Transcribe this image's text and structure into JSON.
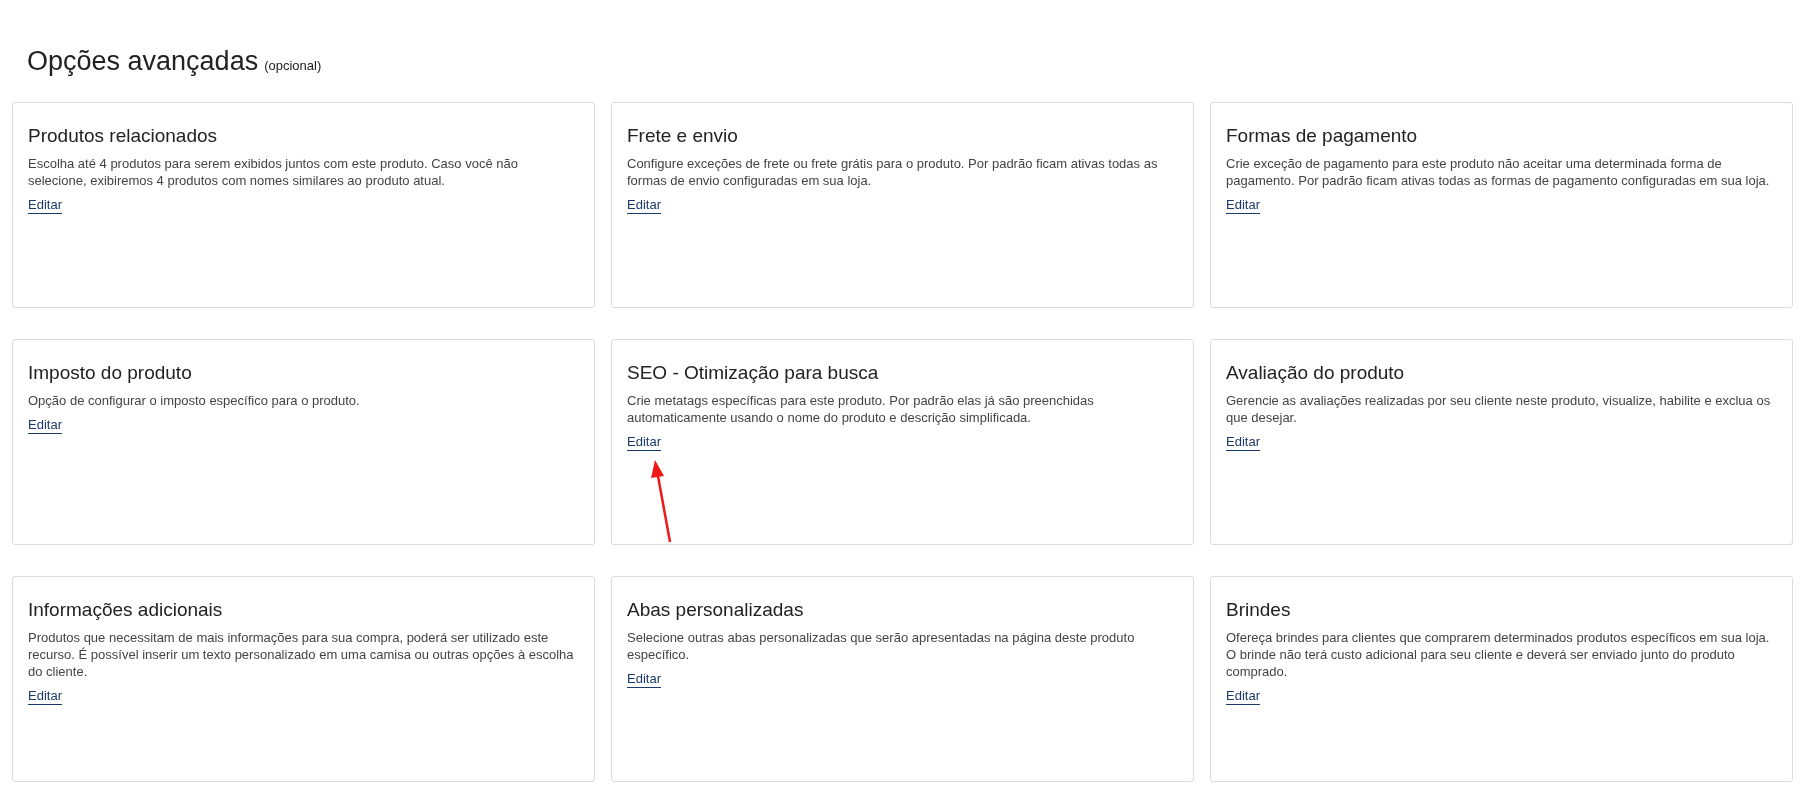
{
  "page": {
    "title": "Opções avançadas",
    "title_note": "(opcional)"
  },
  "cards": [
    {
      "title": "Produtos relacionados",
      "description": "Escolha até 4 produtos para serem exibidos juntos com este produto. Caso você não selecione, exibiremos 4 produtos com nomes similares ao produto atual.",
      "link": "Editar",
      "pointer_arrow": false
    },
    {
      "title": "Frete e envio",
      "description": "Configure exceções de frete ou frete grátis para o produto. Por padrão ficam ativas todas as formas de envio configuradas em sua loja.",
      "link": "Editar",
      "pointer_arrow": false
    },
    {
      "title": "Formas de pagamento",
      "description": "Crie exceção de pagamento para este produto não aceitar uma determinada forma de pagamento. Por padrão ficam ativas todas as formas de pagamento configuradas em sua loja.",
      "link": "Editar",
      "pointer_arrow": false
    },
    {
      "title": "Imposto do produto",
      "description": "Opção de configurar o imposto específico para o produto.",
      "link": "Editar",
      "pointer_arrow": false
    },
    {
      "title": "SEO - Otimização para busca",
      "description": "Crie metatags específicas para este produto. Por padrão elas já são preenchidas automaticamente usando o nome do produto e descrição simplificada.",
      "link": "Editar",
      "pointer_arrow": true
    },
    {
      "title": "Avaliação do produto",
      "description": "Gerencie as avaliações realizadas por seu cliente neste produto, visualize, habilite e exclua os que desejar.",
      "link": "Editar",
      "pointer_arrow": false
    },
    {
      "title": "Informações adicionais",
      "description": "Produtos que necessitam de mais informações para sua compra, poderá ser utilizado este recurso. É possível inserir um texto personalizado em uma camisa ou outras opções à escolha do cliente.",
      "link": "Editar",
      "pointer_arrow": false
    },
    {
      "title": "Abas personalizadas",
      "description": "Selecione outras abas personalizadas que serão apresentadas na página deste produto específico.",
      "link": "Editar",
      "pointer_arrow": false
    },
    {
      "title": "Brindes",
      "description": "Ofereça brindes para clientes que comprarem determinados produtos específicos em sua loja. O brinde não terá custo adicional para seu cliente e deverá ser enviado junto do produto comprado.",
      "link": "Editar",
      "pointer_arrow": false
    }
  ]
}
